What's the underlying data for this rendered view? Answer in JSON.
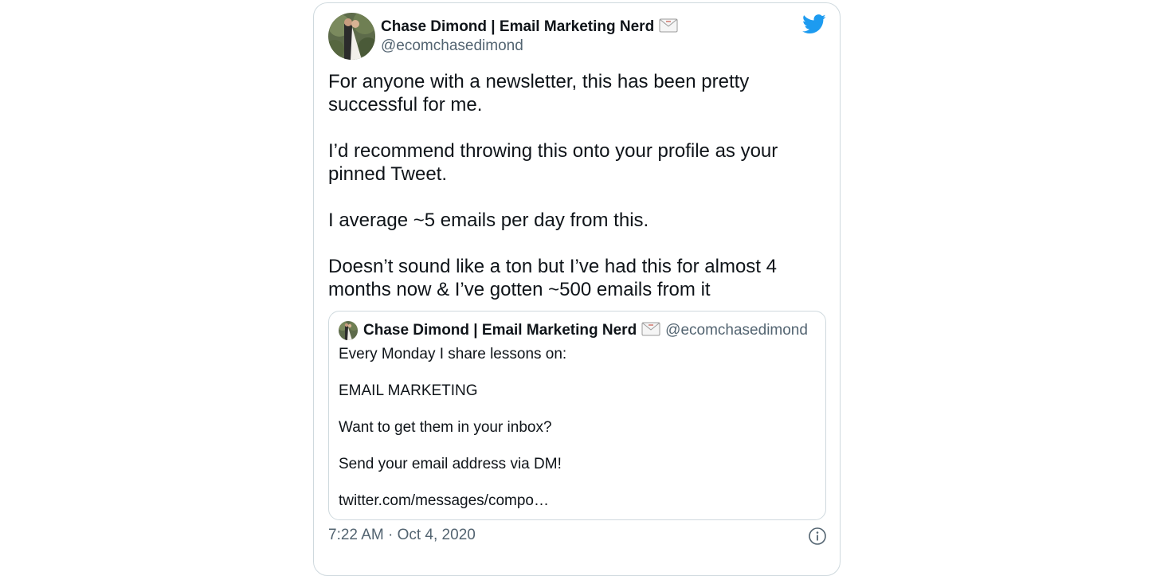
{
  "author": {
    "name": "Chase Dimond | Email Marketing Nerd",
    "handle": "@ecomchasedimond"
  },
  "tweet": {
    "paragraphs": [
      "For anyone with a newsletter, this has been pretty successful for me.",
      "I’d recommend throwing this onto your profile as your pinned Tweet.",
      "I average ~5 emails per day from this.",
      "Doesn’t sound like a ton but I’ve had this for almost 4 months now & I’ve gotten ~500 emails from it"
    ],
    "timestamp": "7:22 AM · Oct 4, 2020"
  },
  "quote": {
    "name": "Chase Dimond | Email Marketing Nerd",
    "handle": "@ecomchasedimond",
    "paragraphs": [
      "Every Monday I share lessons on:",
      "EMAIL MARKETING",
      "Want to get them in your inbox?",
      "Send your email address via DM!",
      "twitter.com/messages/compo…"
    ]
  },
  "icons": {
    "brand": "twitter-bird-icon",
    "envelope": "envelope-icon",
    "info": "info-icon"
  },
  "colors": {
    "twitter_blue": "#1d9bf0",
    "text": "#0f1419",
    "secondary_text": "#536471",
    "border": "#cfd9de"
  }
}
